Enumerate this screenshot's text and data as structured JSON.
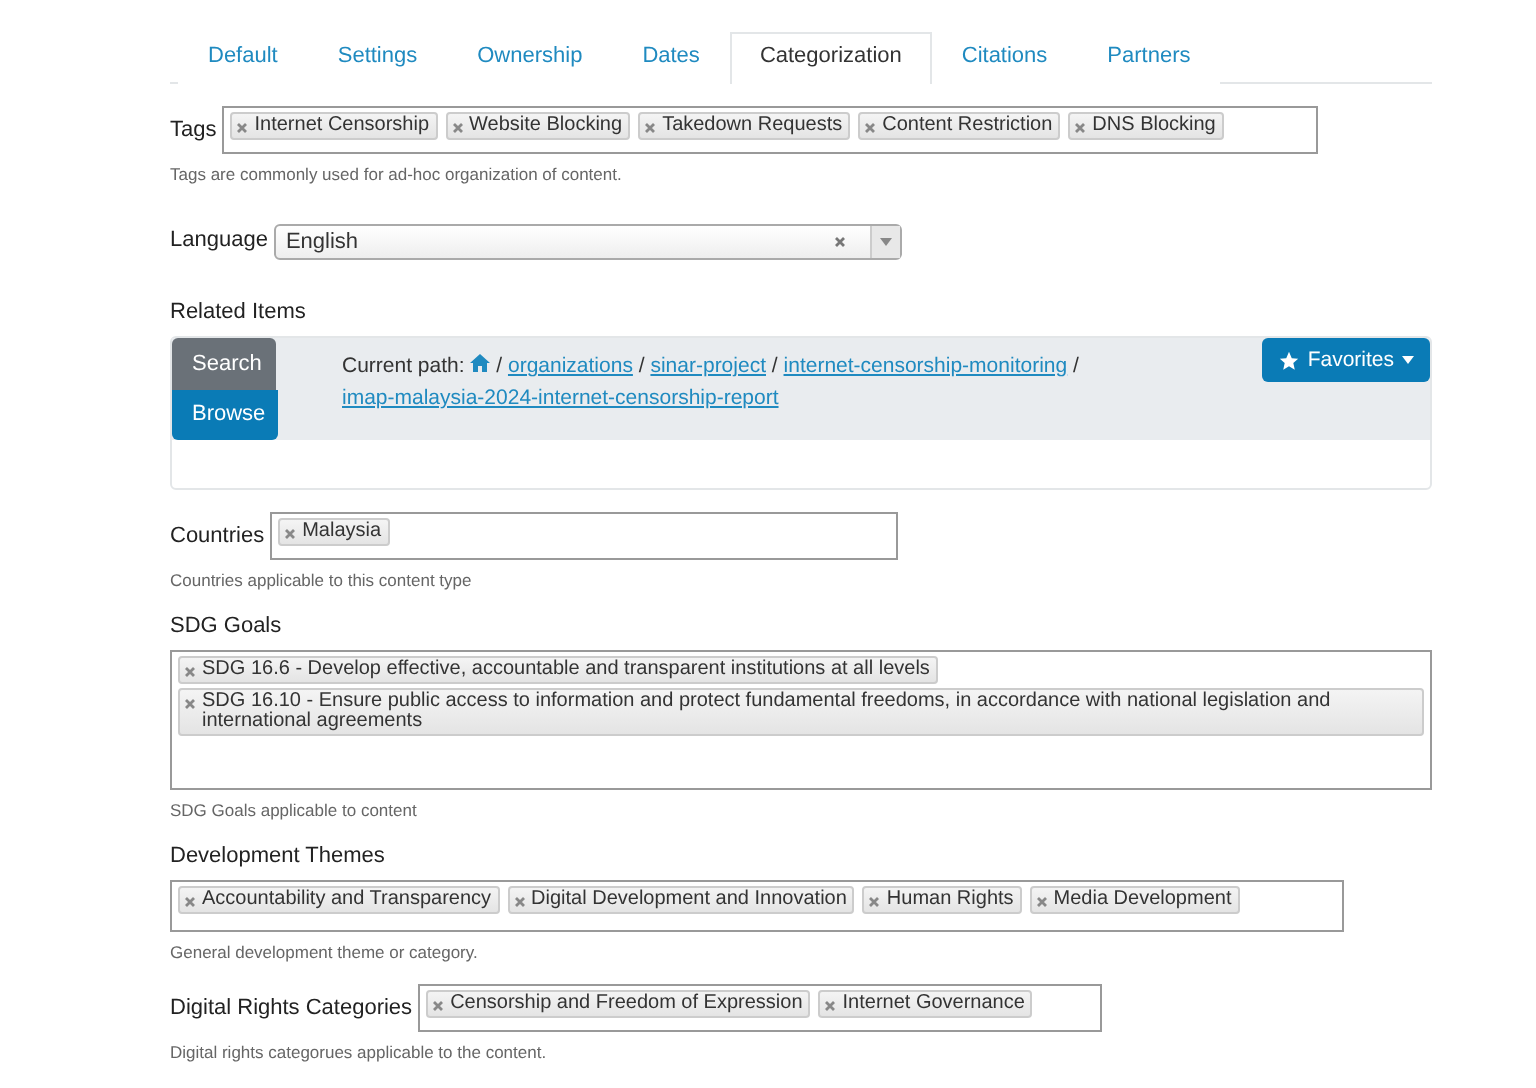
{
  "tabs": [
    {
      "label": "Default",
      "selected": false
    },
    {
      "label": "Settings",
      "selected": false
    },
    {
      "label": "Ownership",
      "selected": false
    },
    {
      "label": "Dates",
      "selected": false
    },
    {
      "label": "Categorization",
      "selected": true
    },
    {
      "label": "Citations",
      "selected": false
    },
    {
      "label": "Partners",
      "selected": false
    }
  ],
  "fields": [
    {
      "kind": "inline-tags",
      "label": "Tags",
      "tags": [
        "Internet Censorship",
        "Website Blocking",
        "Takedown Requests",
        "Content Restriction",
        "DNS Blocking"
      ],
      "help": "Tags are commonly used for ad-hoc organization of content."
    },
    {
      "kind": "select",
      "label": "Language",
      "value": "English"
    },
    {
      "kind": "related",
      "label": "Related Items",
      "buttons": [
        {
          "label": "Search",
          "selected": false
        },
        {
          "label": "Browse",
          "selected": true
        }
      ],
      "path_label": "Current path:",
      "separator": "/",
      "path": [
        "organizations",
        "sinar-project",
        "internet-censorship-monitoring",
        "imap-malaysia-2024-internet-censorship-report"
      ],
      "favorites": "Favorites"
    },
    {
      "kind": "inline-tags",
      "label": "Countries",
      "tags": [
        "Malaysia"
      ],
      "help": "Countries applicable to this content type"
    },
    {
      "kind": "stacked-tags",
      "label": "SDG Goals",
      "tags": [
        "SDG 16.6 - Develop effective, accountable and transparent institutions at all levels",
        "SDG 16.10 - Ensure public access to information and protect fundamental freedoms, in accordance with national legislation and international agreements"
      ],
      "help": "SDG Goals applicable to content"
    },
    {
      "kind": "stacked-tags",
      "label": "Development Themes",
      "tags": [
        "Accountability and Transparency",
        "Digital Development and Innovation",
        "Human Rights",
        "Media Development"
      ],
      "help": "General development theme or category."
    },
    {
      "kind": "inline-tags",
      "label": "Digital Rights Categories",
      "tags": [
        "Censorship and Freedom of Expression",
        "Internet Governance"
      ],
      "help": "Digital rights categorues applicable to the content."
    }
  ]
}
